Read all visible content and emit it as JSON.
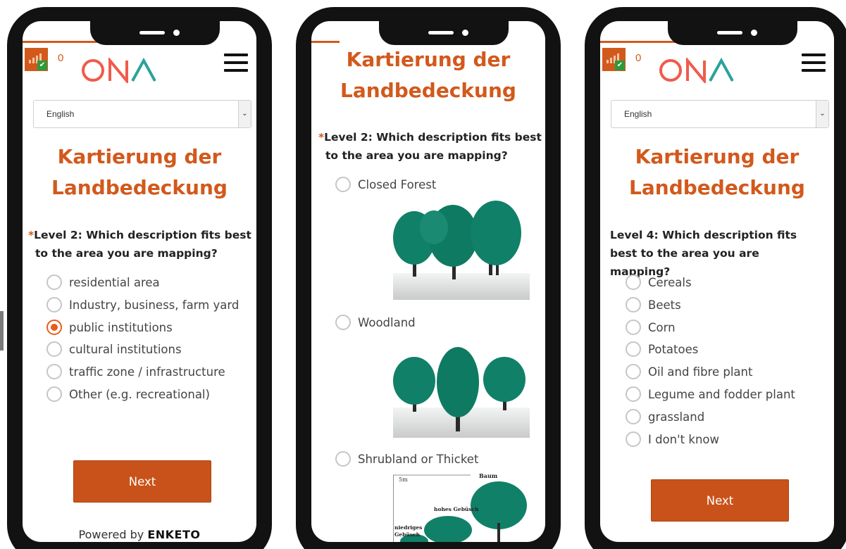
{
  "colors": {
    "accent": "#d2591c",
    "button": "#c9521a",
    "checked_radio": "#e85d1c",
    "tree_green": "#118068"
  },
  "header": {
    "queue_count": "0",
    "logo_text": "ONA",
    "status_icon": "signal-bars-icon",
    "check_icon": "checkmark-icon",
    "menu_icon": "hamburger-menu-icon"
  },
  "form_title_line1": "Kartierung der",
  "form_title_line2": "Landbedeckung",
  "screen1": {
    "language": "English",
    "question_marker": "*",
    "question": "Level 2: Which description fits best to the area you are mapping?",
    "options": [
      "residential area",
      "Industry, business, farm yard",
      "public institutions",
      "cultural institutions",
      "traffic zone / infrastructure",
      "Other (e.g. recreational)"
    ],
    "selected_option": "public institutions",
    "next_label": "Next",
    "powered_prefix": "Powered by",
    "powered_brand": "ENKETO"
  },
  "screen2": {
    "question_marker": "*",
    "question": "Level 2: Which description fits best to the area you are mapping?",
    "options": [
      "Closed Forest",
      "Woodland",
      "Shrubland or Thicket"
    ],
    "figure_labels": {
      "height_mark": "5m",
      "tree": "Baum",
      "tall_shrub": "hohes Gebüsch",
      "low_shrub_1": "niedriges",
      "low_shrub_2": "Gebüsch"
    }
  },
  "screen3": {
    "language": "English",
    "question": "Level 4: Which description fits best to the area you are mapping?",
    "options": [
      "Cereals",
      "Beets",
      "Corn",
      "Potatoes",
      "Oil and fibre plant",
      "Legume and fodder plant",
      "grassland",
      "I don't know"
    ],
    "next_label": "Next"
  }
}
